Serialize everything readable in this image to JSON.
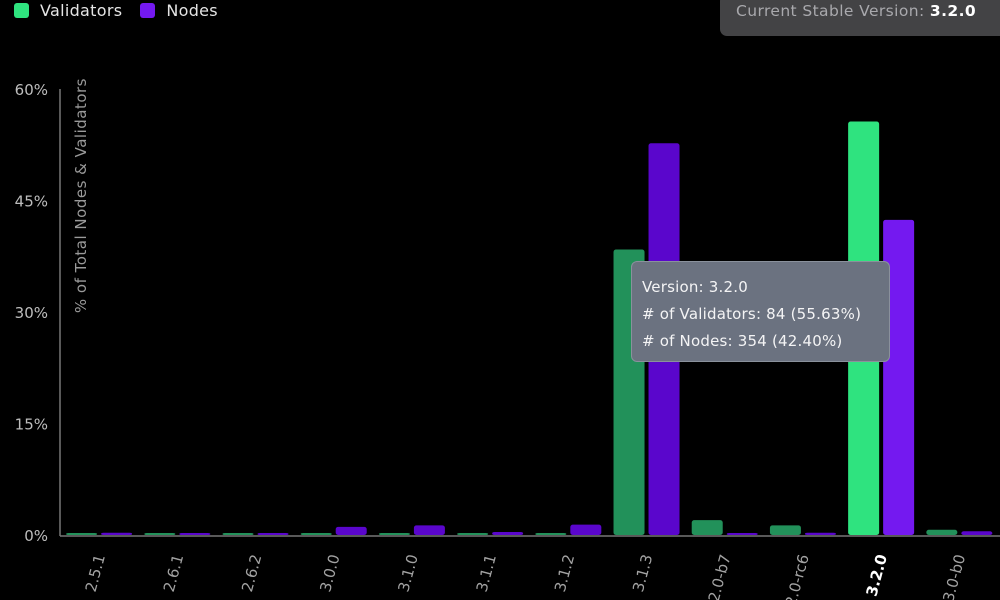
{
  "legend": {
    "validators": {
      "label": "Validators",
      "color": "#2fe37f"
    },
    "nodes": {
      "label": "Nodes",
      "color": "#7419f0"
    }
  },
  "stable_version": {
    "label": "Current Stable Version:",
    "value": "3.2.0"
  },
  "tooltip": {
    "version": "Version: 3.2.0",
    "validators": "# of Validators: 84 (55.63%)",
    "nodes": "# of Nodes: 354 (42.40%)"
  },
  "chart_data": {
    "type": "bar",
    "ylabel": "% of Total Nodes & Validators",
    "ylim": [
      0,
      60
    ],
    "yticks": [
      {
        "value": 0,
        "label": "0%"
      },
      {
        "value": 15,
        "label": "15%"
      },
      {
        "value": 30,
        "label": "30%"
      },
      {
        "value": 45,
        "label": "45%"
      },
      {
        "value": 60,
        "label": "60%"
      }
    ],
    "categories": [
      "2.5.1",
      "2.6.1",
      "2.6.2",
      "3.0.0",
      "3.1.0",
      "3.1.1",
      "3.1.2",
      "3.1.3",
      "2.0-b7",
      "2.0-rc6",
      "3.2.0",
      "3.0-b0"
    ],
    "highlight_category": "3.2.0",
    "series": [
      {
        "name": "Validators",
        "color": "#2fe37f",
        "values": [
          0,
          0,
          0,
          0,
          0,
          0,
          0,
          38.4,
          2.0,
          1.3,
          55.63,
          0.7
        ]
      },
      {
        "name": "Nodes",
        "color": "#7419f0",
        "values": [
          0.3,
          0.2,
          0.2,
          1.1,
          1.3,
          0.4,
          1.4,
          52.7,
          0.2,
          0.3,
          42.4,
          0.5
        ]
      }
    ],
    "active_category": "3.2.0"
  }
}
